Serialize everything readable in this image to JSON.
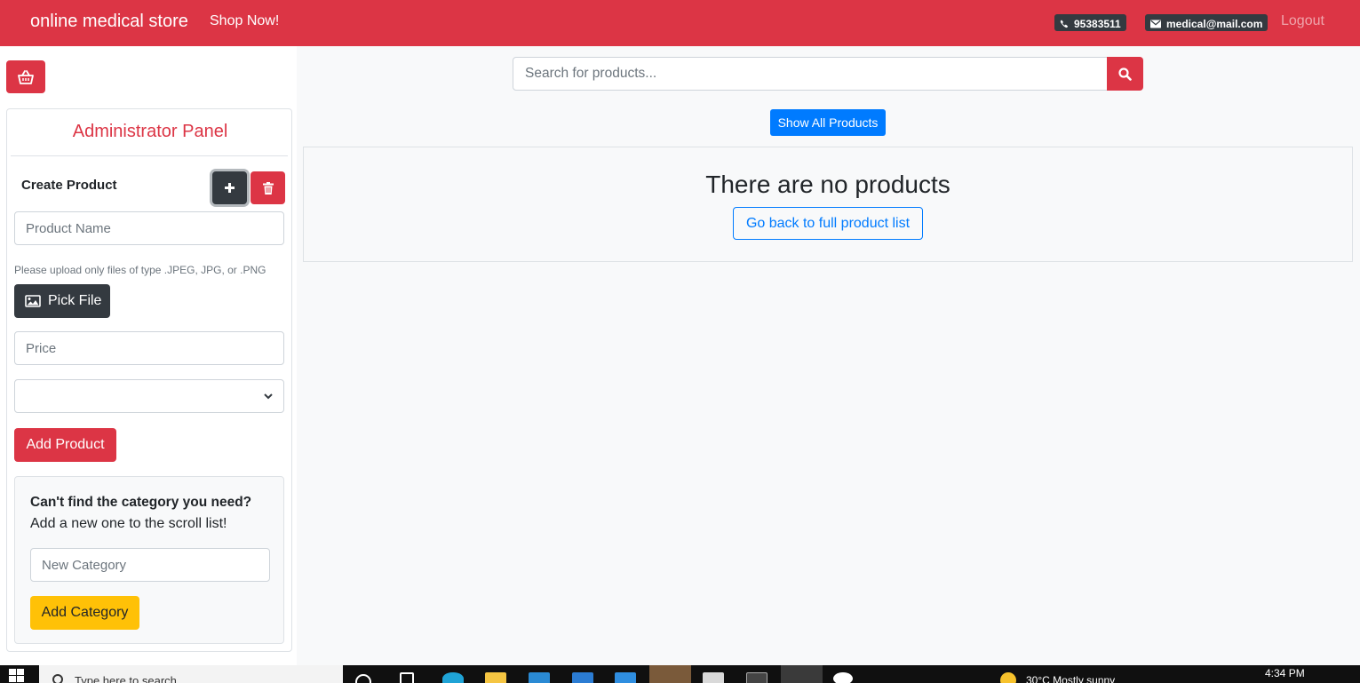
{
  "navbar": {
    "brand": "online medical store",
    "shop_link": "Shop Now!",
    "phone": "95383511",
    "email": "medical@mail.com",
    "logout": "Logout"
  },
  "sidebar": {
    "admin_title": "Administrator Panel",
    "create_label": "Create Product",
    "product_name_placeholder": "Product Name",
    "upload_hint": "Please upload only files of type .JPEG, JPG, or .PNG",
    "pick_file_label": "Pick File",
    "price_placeholder": "Price",
    "category_selected": "",
    "add_product_label": "Add Product",
    "category_box": {
      "question": "Can't find the category you need?",
      "subtitle": "Add a new one to the scroll list!",
      "new_category_placeholder": "New Category",
      "add_category_label": "Add Category"
    }
  },
  "main": {
    "search_placeholder": "Search for products...",
    "show_all_label": "Show All Products",
    "empty_title": "There are no products",
    "back_label": "Go back to full product list"
  },
  "taskbar": {
    "search_text": "Type here to search",
    "weather": "30°C  Mostly sunny",
    "time": "4:34 PM"
  },
  "colors": {
    "brand": "#dc3545",
    "dark": "#343a40",
    "primary": "#007bff",
    "warning": "#ffc107"
  },
  "icons": [
    "phone-icon",
    "envelope-icon",
    "shopping-basket-icon",
    "plus-icon",
    "trash-icon",
    "image-icon",
    "chevron-down-icon",
    "search-icon",
    "windows-icon"
  ]
}
